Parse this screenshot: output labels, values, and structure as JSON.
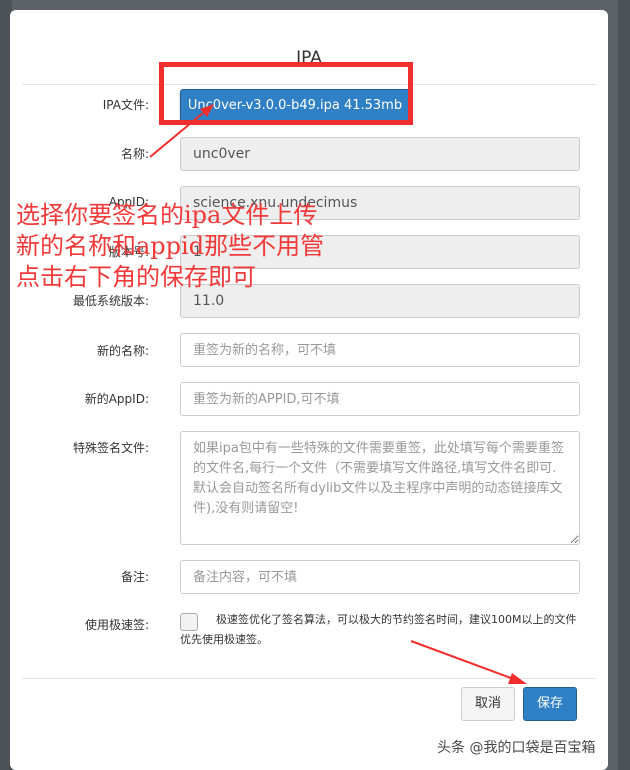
{
  "modal": {
    "title": "IPA",
    "labels": {
      "ipa_file": "IPA文件:",
      "name": "名称:",
      "appid": "AppID:",
      "version": "版本号:",
      "min_os": "最低系统版本:",
      "new_name": "新的名称:",
      "new_appid": "新的AppID:",
      "special_files": "特殊签名文件:",
      "note": "备注:",
      "fast_sign": "使用极速签:"
    },
    "file_button_label": "Unc0ver-v3.0.0-b49.ipa 41.53mb",
    "values": {
      "name": "unc0ver",
      "appid": "science.xnu.undecimus",
      "version": "1",
      "min_os": "11.0"
    },
    "placeholders": {
      "new_name": "重签为新的名称，可不填",
      "new_appid": "重签为新的APPID,可不填",
      "special_files": "如果ipa包中有一些特殊的文件需要重签，此处填写每个需要重签的文件名,每行一个文件（不需要填写文件路径,填写文件名即可.默认会自动签名所有dylib文件以及主程序中声明的动态链接库文件),没有则请留空!",
      "note": "备注内容，可不填"
    },
    "fast_sign_text": "极速签优化了签名算法，可以极大的节约签名时间，建议100M以上的文件优先使用极速签。",
    "buttons": {
      "cancel": "取消",
      "save": "保存"
    }
  },
  "annotation": {
    "lines": [
      "选择你要签名的ipa文件上传",
      "新的名称和appid那些不用管",
      "点击右下角的保存即可"
    ],
    "color": "#f03a3a"
  },
  "watermark": "头条 @我的口袋是百宝箱",
  "colors": {
    "primary": "#2f80c5",
    "highlight": "#f02e2e"
  }
}
